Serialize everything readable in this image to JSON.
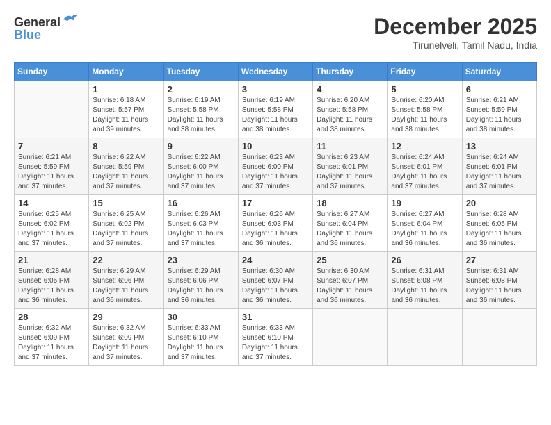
{
  "header": {
    "logo_line1": "General",
    "logo_line2": "Blue",
    "month": "December 2025",
    "location": "Tirunelveli, Tamil Nadu, India"
  },
  "weekdays": [
    "Sunday",
    "Monday",
    "Tuesday",
    "Wednesday",
    "Thursday",
    "Friday",
    "Saturday"
  ],
  "weeks": [
    [
      {
        "day": "",
        "info": ""
      },
      {
        "day": "1",
        "info": "Sunrise: 6:18 AM\nSunset: 5:57 PM\nDaylight: 11 hours\nand 39 minutes."
      },
      {
        "day": "2",
        "info": "Sunrise: 6:19 AM\nSunset: 5:58 PM\nDaylight: 11 hours\nand 38 minutes."
      },
      {
        "day": "3",
        "info": "Sunrise: 6:19 AM\nSunset: 5:58 PM\nDaylight: 11 hours\nand 38 minutes."
      },
      {
        "day": "4",
        "info": "Sunrise: 6:20 AM\nSunset: 5:58 PM\nDaylight: 11 hours\nand 38 minutes."
      },
      {
        "day": "5",
        "info": "Sunrise: 6:20 AM\nSunset: 5:58 PM\nDaylight: 11 hours\nand 38 minutes."
      },
      {
        "day": "6",
        "info": "Sunrise: 6:21 AM\nSunset: 5:59 PM\nDaylight: 11 hours\nand 38 minutes."
      }
    ],
    [
      {
        "day": "7",
        "info": "Sunrise: 6:21 AM\nSunset: 5:59 PM\nDaylight: 11 hours\nand 37 minutes."
      },
      {
        "day": "8",
        "info": "Sunrise: 6:22 AM\nSunset: 5:59 PM\nDaylight: 11 hours\nand 37 minutes."
      },
      {
        "day": "9",
        "info": "Sunrise: 6:22 AM\nSunset: 6:00 PM\nDaylight: 11 hours\nand 37 minutes."
      },
      {
        "day": "10",
        "info": "Sunrise: 6:23 AM\nSunset: 6:00 PM\nDaylight: 11 hours\nand 37 minutes."
      },
      {
        "day": "11",
        "info": "Sunrise: 6:23 AM\nSunset: 6:01 PM\nDaylight: 11 hours\nand 37 minutes."
      },
      {
        "day": "12",
        "info": "Sunrise: 6:24 AM\nSunset: 6:01 PM\nDaylight: 11 hours\nand 37 minutes."
      },
      {
        "day": "13",
        "info": "Sunrise: 6:24 AM\nSunset: 6:01 PM\nDaylight: 11 hours\nand 37 minutes."
      }
    ],
    [
      {
        "day": "14",
        "info": "Sunrise: 6:25 AM\nSunset: 6:02 PM\nDaylight: 11 hours\nand 37 minutes."
      },
      {
        "day": "15",
        "info": "Sunrise: 6:25 AM\nSunset: 6:02 PM\nDaylight: 11 hours\nand 37 minutes."
      },
      {
        "day": "16",
        "info": "Sunrise: 6:26 AM\nSunset: 6:03 PM\nDaylight: 11 hours\nand 37 minutes."
      },
      {
        "day": "17",
        "info": "Sunrise: 6:26 AM\nSunset: 6:03 PM\nDaylight: 11 hours\nand 36 minutes."
      },
      {
        "day": "18",
        "info": "Sunrise: 6:27 AM\nSunset: 6:04 PM\nDaylight: 11 hours\nand 36 minutes."
      },
      {
        "day": "19",
        "info": "Sunrise: 6:27 AM\nSunset: 6:04 PM\nDaylight: 11 hours\nand 36 minutes."
      },
      {
        "day": "20",
        "info": "Sunrise: 6:28 AM\nSunset: 6:05 PM\nDaylight: 11 hours\nand 36 minutes."
      }
    ],
    [
      {
        "day": "21",
        "info": "Sunrise: 6:28 AM\nSunset: 6:05 PM\nDaylight: 11 hours\nand 36 minutes."
      },
      {
        "day": "22",
        "info": "Sunrise: 6:29 AM\nSunset: 6:06 PM\nDaylight: 11 hours\nand 36 minutes."
      },
      {
        "day": "23",
        "info": "Sunrise: 6:29 AM\nSunset: 6:06 PM\nDaylight: 11 hours\nand 36 minutes."
      },
      {
        "day": "24",
        "info": "Sunrise: 6:30 AM\nSunset: 6:07 PM\nDaylight: 11 hours\nand 36 minutes."
      },
      {
        "day": "25",
        "info": "Sunrise: 6:30 AM\nSunset: 6:07 PM\nDaylight: 11 hours\nand 36 minutes."
      },
      {
        "day": "26",
        "info": "Sunrise: 6:31 AM\nSunset: 6:08 PM\nDaylight: 11 hours\nand 36 minutes."
      },
      {
        "day": "27",
        "info": "Sunrise: 6:31 AM\nSunset: 6:08 PM\nDaylight: 11 hours\nand 36 minutes."
      }
    ],
    [
      {
        "day": "28",
        "info": "Sunrise: 6:32 AM\nSunset: 6:09 PM\nDaylight: 11 hours\nand 37 minutes."
      },
      {
        "day": "29",
        "info": "Sunrise: 6:32 AM\nSunset: 6:09 PM\nDaylight: 11 hours\nand 37 minutes."
      },
      {
        "day": "30",
        "info": "Sunrise: 6:33 AM\nSunset: 6:10 PM\nDaylight: 11 hours\nand 37 minutes."
      },
      {
        "day": "31",
        "info": "Sunrise: 6:33 AM\nSunset: 6:10 PM\nDaylight: 11 hours\nand 37 minutes."
      },
      {
        "day": "",
        "info": ""
      },
      {
        "day": "",
        "info": ""
      },
      {
        "day": "",
        "info": ""
      }
    ]
  ]
}
